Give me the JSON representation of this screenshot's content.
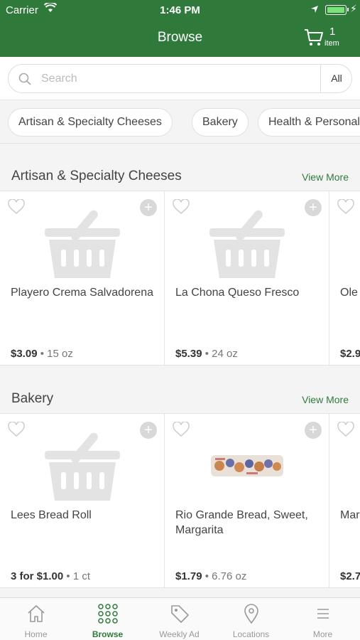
{
  "status_bar": {
    "carrier": "Carrier",
    "time": "1:46 PM"
  },
  "header": {
    "title": "Browse",
    "cart_count": "1",
    "cart_unit": "item"
  },
  "search": {
    "placeholder": "Search",
    "scope": "All"
  },
  "categories": [
    "Artisan & Specialty Cheeses",
    "Bakery",
    "Health & Personal Care"
  ],
  "sections": [
    {
      "title": "Artisan & Specialty Cheeses",
      "view_more": "View More",
      "products": [
        {
          "name": "Playero Crema Salvadorena",
          "price": "$3.09",
          "size": "15 oz"
        },
        {
          "name": "La Chona Queso Fresco",
          "price": "$5.39",
          "size": "24 oz"
        },
        {
          "name": "Ole",
          "price": "$2.9",
          "size": ""
        }
      ]
    },
    {
      "title": "Bakery",
      "view_more": "View More",
      "products": [
        {
          "name": "Lees Bread Roll",
          "price": "3 for $1.00",
          "size": "1 ct"
        },
        {
          "name": "Rio Grande Bread, Sweet, Margarita",
          "price": "$1.79",
          "size": "6.76 oz"
        },
        {
          "name": "Mar Stra",
          "price": "$2.7",
          "size": ""
        }
      ]
    }
  ],
  "tabs": [
    {
      "label": "Home",
      "icon": "home-icon"
    },
    {
      "label": "Browse",
      "icon": "grid-icon"
    },
    {
      "label": "Weekly Ad",
      "icon": "tag-icon"
    },
    {
      "label": "Locations",
      "icon": "location-pin-icon"
    },
    {
      "label": "More",
      "icon": "menu-icon"
    }
  ],
  "colors": {
    "brand_green": "#2f7a3b",
    "link_green": "#2f7a3b"
  }
}
